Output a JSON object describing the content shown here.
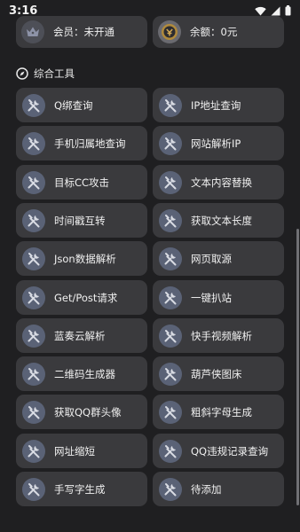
{
  "status": {
    "time": "3:16"
  },
  "top": {
    "membership_label": "会员：未开通",
    "balance_label": "余额：0元"
  },
  "section": {
    "title": "综合工具"
  },
  "tools": [
    {
      "label": "Q绑查询"
    },
    {
      "label": "IP地址查询"
    },
    {
      "label": "手机归属地查询"
    },
    {
      "label": "网站解析IP"
    },
    {
      "label": "目标CC攻击"
    },
    {
      "label": "文本内容替换"
    },
    {
      "label": "时间戳互转"
    },
    {
      "label": "获取文本长度"
    },
    {
      "label": "Json数据解析"
    },
    {
      "label": "网页取源"
    },
    {
      "label": "Get/Post请求"
    },
    {
      "label": "一键扒站"
    },
    {
      "label": "蓝奏云解析"
    },
    {
      "label": "快手视频解析"
    },
    {
      "label": "二维码生成器"
    },
    {
      "label": "葫芦侠图床"
    },
    {
      "label": "获取QQ群头像"
    },
    {
      "label": "粗斜字母生成"
    },
    {
      "label": "网址缩短"
    },
    {
      "label": "QQ违规记录查询"
    },
    {
      "label": "手写字生成"
    },
    {
      "label": "待添加"
    }
  ],
  "icons": {
    "tool": "tools-icon",
    "membership": "crown-icon",
    "balance": "coin-icon",
    "section": "compass-icon",
    "wifi": "wifi-icon",
    "signal": "signal-icon",
    "battery": "battery-icon"
  },
  "colors": {
    "background": "#1f1f21",
    "card": "#3a3a3d",
    "icon_circle": "#5a6276",
    "text": "#f0f0f0"
  }
}
